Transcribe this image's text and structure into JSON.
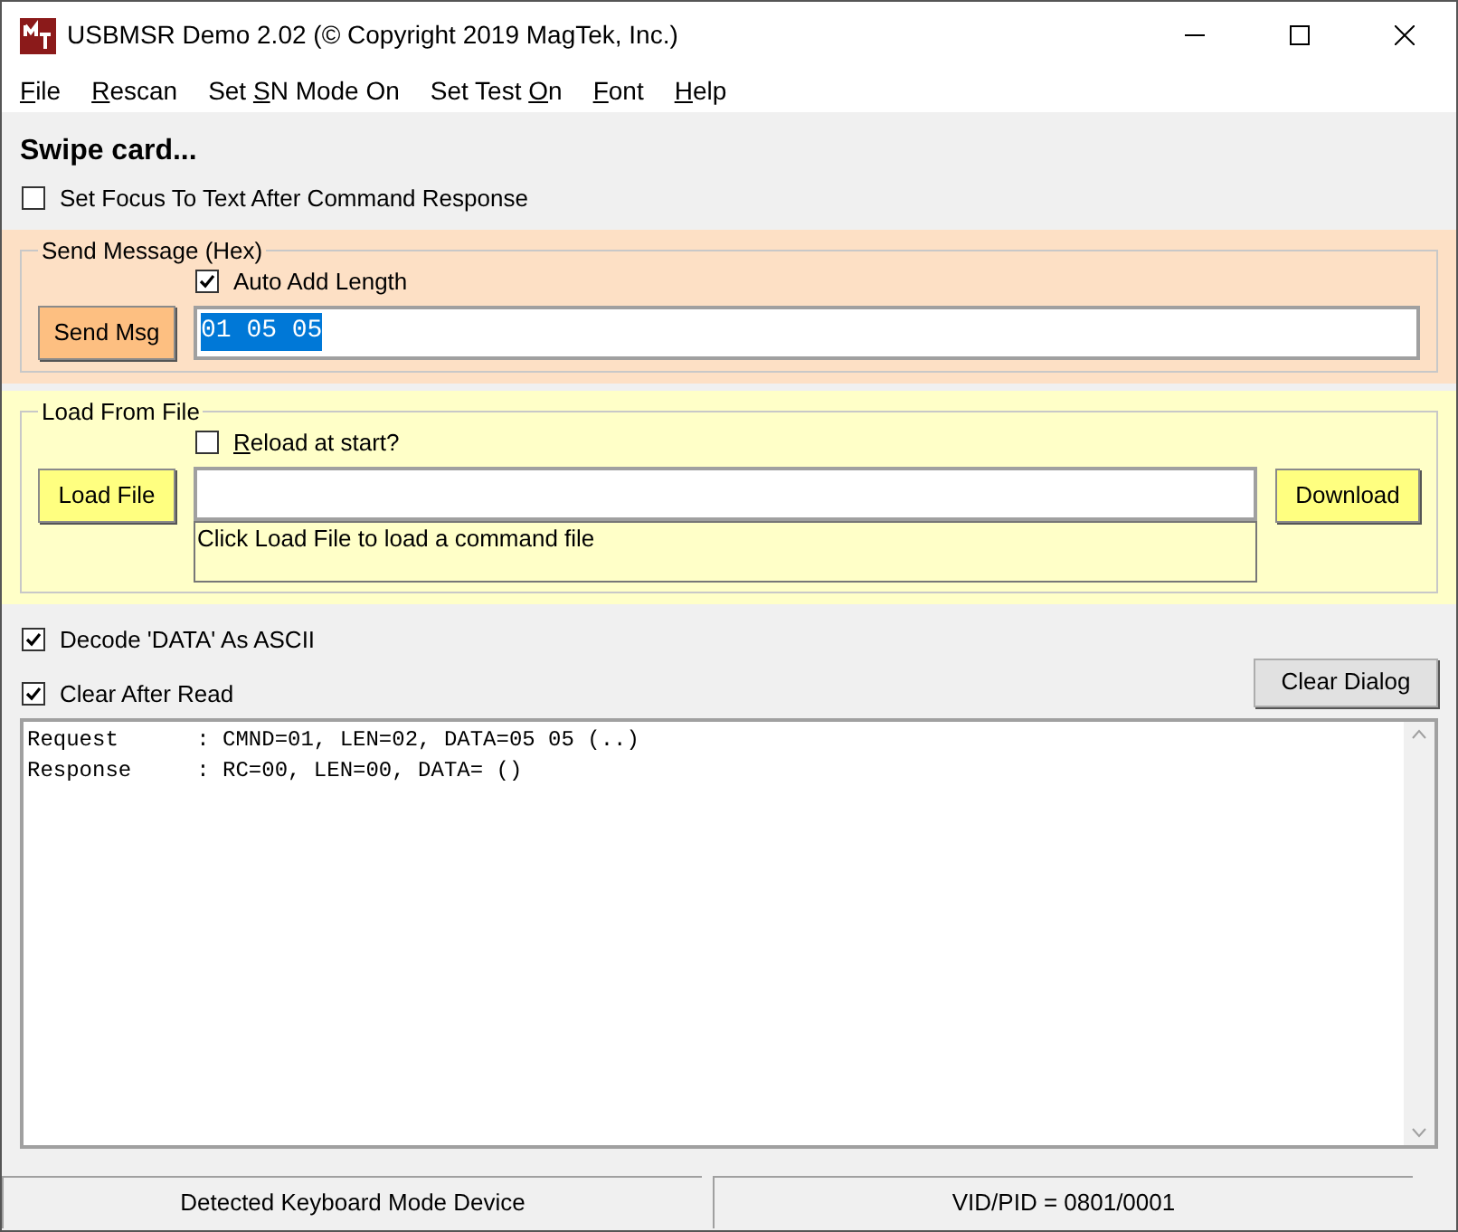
{
  "window": {
    "title": "USBMSR Demo 2.02 (© Copyright 2019 MagTek, Inc.)"
  },
  "menu": [
    {
      "key": "F",
      "post": "ile"
    },
    {
      "key": "R",
      "post": "escan"
    },
    {
      "pre": "Set ",
      "key": "S",
      "post": "N Mode On"
    },
    {
      "pre": "Set Test ",
      "key": "O",
      "post": "n"
    },
    {
      "key": "F",
      "post": "ont"
    },
    {
      "key": "H",
      "post": "elp"
    }
  ],
  "status_heading": "Swipe card...",
  "focus_checkbox": {
    "label": "Set Focus To Text After Command Response",
    "checked": false
  },
  "send_message": {
    "title": "Send Message (Hex)",
    "auto_add_length": {
      "label": "Auto Add Length",
      "checked": true
    },
    "button": "Send Msg",
    "value": "01 05 05"
  },
  "load_from_file": {
    "title": "Load From File",
    "reload": {
      "key": "R",
      "post": "eload at start?",
      "checked": false
    },
    "button": "Load File",
    "download": "Download",
    "hint": "Click Load File to load a command file"
  },
  "decode_checkbox": {
    "label": "Decode 'DATA' As ASCII",
    "checked": true
  },
  "clear_checkbox": {
    "label": "Clear After Read",
    "checked": true
  },
  "clear_button": "Clear Dialog",
  "log": [
    "Request      : CMND=01, LEN=02, DATA=05 05 (..)",
    "Response     : RC=00, LEN=00, DATA= ()"
  ],
  "status_bar": [
    "Detected Keyboard Mode Device",
    "VID/PID = 0801/0001"
  ]
}
